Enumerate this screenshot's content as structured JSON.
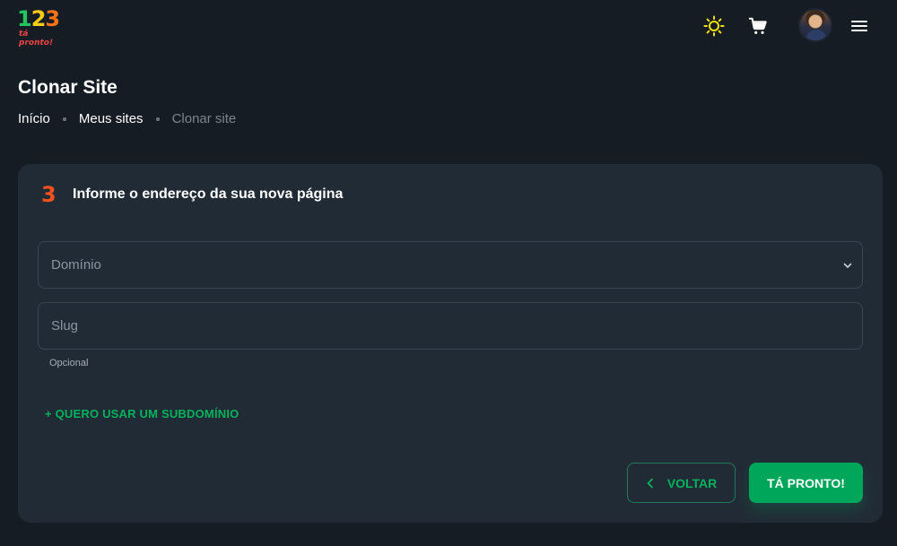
{
  "logo": {
    "digits": [
      "1",
      "2",
      "3"
    ],
    "tagline": "tá pronto!"
  },
  "header": {
    "icons": [
      "sun-icon",
      "cart-icon",
      "avatar",
      "menu-icon"
    ]
  },
  "page": {
    "title": "Clonar Site",
    "breadcrumb": [
      "Início",
      "Meus sites",
      "Clonar site"
    ]
  },
  "step": {
    "number": "3",
    "title": "Informe o endereço da sua nova página"
  },
  "form": {
    "domain_placeholder": "Domínio",
    "slug_placeholder": "Slug",
    "slug_hint": "Opcional",
    "subdomain_link": "+ QUERO USAR UM SUBDOMÍNIO"
  },
  "actions": {
    "back_label": "VOLTAR",
    "done_label": "TÁ PRONTO!"
  },
  "colors": {
    "background": "#161c24",
    "card": "#212b36",
    "accent_green": "#00a75a",
    "step_orange": "#f4511e"
  }
}
